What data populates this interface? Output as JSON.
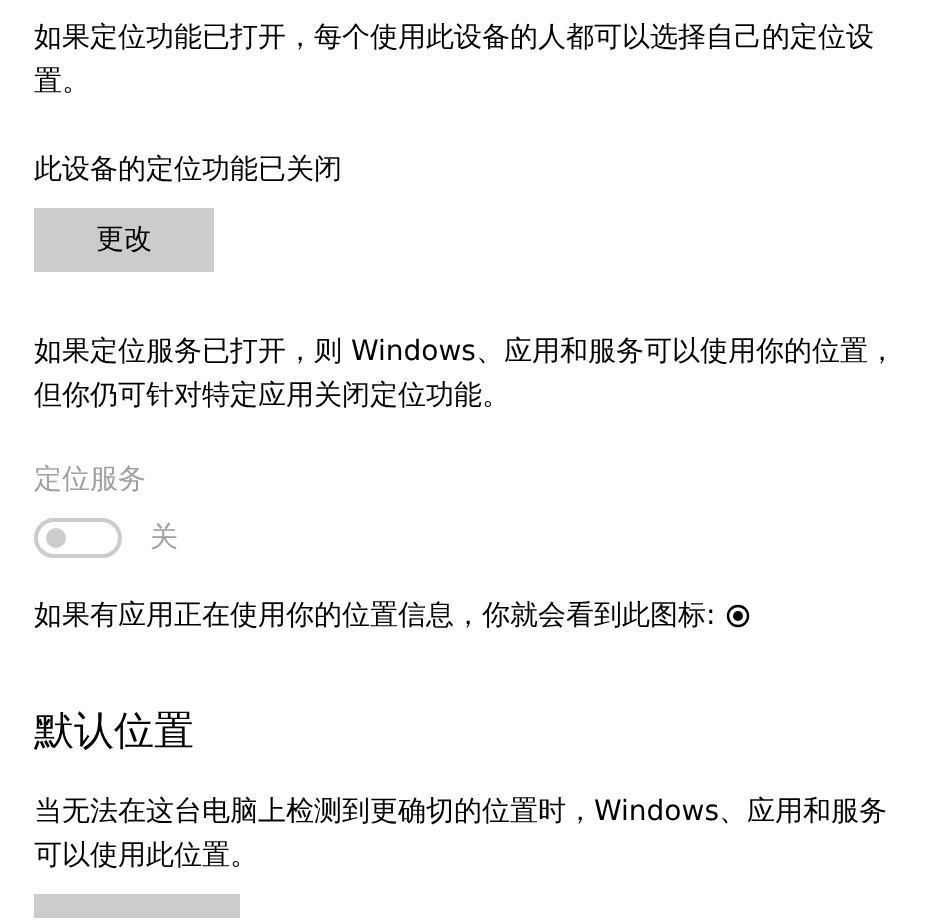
{
  "location_intro": "如果定位功能已打开，每个使用此设备的人都可以选择自己的定位设置。",
  "device_status": "此设备的定位功能已关闭",
  "change_button": "更改",
  "service_intro": "如果定位服务已打开，则 Windows、应用和服务可以使用你的位置，但你仍可针对特定应用关闭定位功能。",
  "location_service": {
    "label": "定位服务",
    "on": false,
    "disabled": true,
    "state_text": "关"
  },
  "icon_note": "如果有应用正在使用你的位置信息，你就会看到此图标:",
  "default_location": {
    "heading": "默认位置",
    "description": "当无法在这台电脑上检测到更确切的位置时，Windows、应用和服务可以使用此位置。"
  }
}
